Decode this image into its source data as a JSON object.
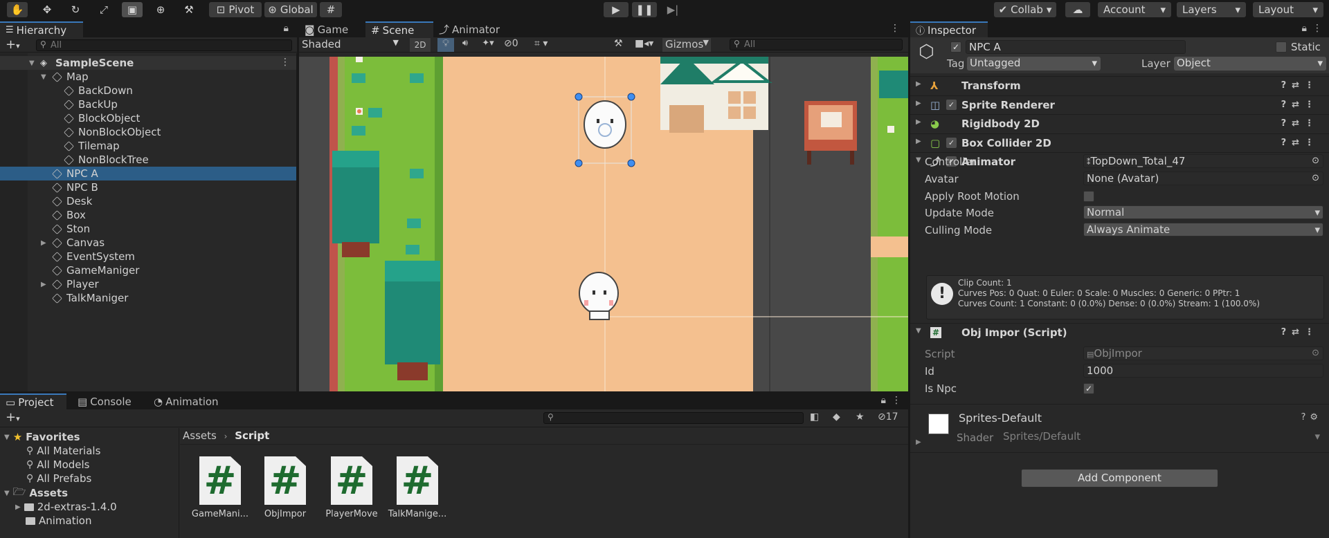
{
  "toolbar": {
    "pivot_label": "Pivot",
    "global_label": "Global",
    "collab_label": "Collab",
    "account_label": "Account",
    "layers_label": "Layers",
    "layout_label": "Layout"
  },
  "hierarchy": {
    "tab_label": "Hierarchy",
    "search_placeholder": "All",
    "scene_name": "SampleScene",
    "items": [
      {
        "label": "Map",
        "depth": 1,
        "fold": "open"
      },
      {
        "label": "BackDown",
        "depth": 2
      },
      {
        "label": "BackUp",
        "depth": 2
      },
      {
        "label": "BlockObject",
        "depth": 2
      },
      {
        "label": "NonBlockObject",
        "depth": 2
      },
      {
        "label": "Tilemap",
        "depth": 2
      },
      {
        "label": "NonBlockTree",
        "depth": 2
      },
      {
        "label": "NPC A",
        "depth": 1,
        "selected": true
      },
      {
        "label": "NPC B",
        "depth": 1
      },
      {
        "label": "Desk",
        "depth": 1
      },
      {
        "label": "Box",
        "depth": 1
      },
      {
        "label": "Ston",
        "depth": 1
      },
      {
        "label": "Canvas",
        "depth": 1,
        "fold": "closed"
      },
      {
        "label": "EventSystem",
        "depth": 1
      },
      {
        "label": "GameManiger",
        "depth": 1
      },
      {
        "label": "Player",
        "depth": 1,
        "fold": "closed"
      },
      {
        "label": "TalkManiger",
        "depth": 1
      }
    ]
  },
  "scene_view": {
    "tabs": [
      "Game",
      "Scene",
      "Animator"
    ],
    "shading_mode": "Shaded",
    "mode_2d": "2D",
    "hidden_count": "0",
    "gizmos_label": "Gizmos",
    "search_placeholder": "All"
  },
  "inspector": {
    "tab_label": "Inspector",
    "object_name": "NPC A",
    "static_label": "Static",
    "tag_label": "Tag",
    "tag_value": "Untagged",
    "layer_label": "Layer",
    "layer_value": "Object",
    "components": [
      {
        "name": "Transform",
        "has_checkbox": false
      },
      {
        "name": "Sprite Renderer",
        "has_checkbox": true
      },
      {
        "name": "Rigidbody 2D",
        "has_checkbox": false
      },
      {
        "name": "Box Collider 2D",
        "has_checkbox": true
      },
      {
        "name": "Animator",
        "has_checkbox": true
      }
    ],
    "animator": {
      "controller_label": "Controller",
      "controller_value": "TopDown_Total_47",
      "avatar_label": "Avatar",
      "avatar_value": "None (Avatar)",
      "root_motion_label": "Apply Root Motion",
      "update_mode_label": "Update Mode",
      "update_mode_value": "Normal",
      "culling_mode_label": "Culling Mode",
      "culling_mode_value": "Always Animate",
      "info_line1": "Clip Count: 1",
      "info_line2": "Curves Pos: 0 Quat: 0 Euler: 0 Scale: 0 Muscles: 0 Generic: 0 PPtr: 1",
      "info_line3": "Curves Count: 1 Constant: 0 (0.0%) Dense: 0 (0.0%) Stream: 1 (100.0%)"
    },
    "script_component": {
      "name": "Obj Impor (Script)",
      "script_label": "Script",
      "script_value": "ObjImpor",
      "id_label": "Id",
      "id_value": "1000",
      "is_npc_label": "Is Npc"
    },
    "material": {
      "name": "Sprites-Default",
      "shader_label": "Shader",
      "shader_value": "Sprites/Default"
    },
    "add_component_label": "Add Component"
  },
  "project": {
    "tabs": [
      "Project",
      "Console",
      "Animation"
    ],
    "hidden_count": "17",
    "favorites_label": "Favorites",
    "favorites": [
      "All Materials",
      "All Models",
      "All Prefabs"
    ],
    "assets_label": "Assets",
    "asset_folders": [
      "2d-extras-1.4.0",
      "Animation"
    ],
    "breadcrumb_root": "Assets",
    "breadcrumb_current": "Script",
    "files": [
      "GameMani...",
      "ObjImpor",
      "PlayerMove",
      "TalkManige..."
    ]
  },
  "colors": {
    "selection": "#2c5d87",
    "accent_tab": "#3a79bb",
    "sand": "#f4c08f",
    "grass": "#7cbd3b"
  }
}
